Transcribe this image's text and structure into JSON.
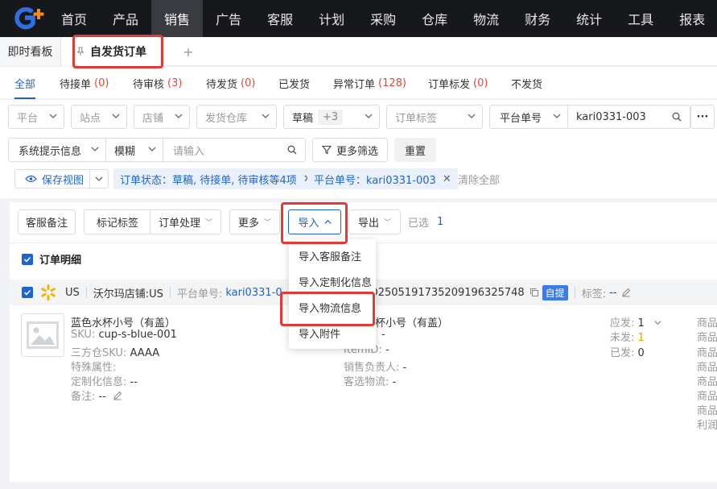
{
  "nav": {
    "items": [
      "首页",
      "产品",
      "销售",
      "广告",
      "客服",
      "计划",
      "采购",
      "仓库",
      "物流",
      "财务",
      "统计",
      "工具",
      "报表"
    ],
    "active_index": 2
  },
  "tabs": {
    "home": "即时看板",
    "current": "自发货订单",
    "add": "+"
  },
  "status_tabs": [
    {
      "label": "全部",
      "count": ""
    },
    {
      "label": "待接单",
      "count": "(0)"
    },
    {
      "label": "待审核",
      "count": "(3)"
    },
    {
      "label": "待发货",
      "count": "(0)"
    },
    {
      "label": "已发货",
      "count": ""
    },
    {
      "label": "异常订单",
      "count": "(128)"
    },
    {
      "label": "订单标发",
      "count": "(0)"
    },
    {
      "label": "不发货",
      "count": ""
    }
  ],
  "filters": {
    "platform": "平台",
    "site": "站点",
    "shop": "店铺",
    "warehouse": "发货仓库",
    "status": "草稿",
    "status_more": "+3",
    "order_tag": "订单标签",
    "search_field": "平台单号",
    "search_value": "kari0331-003",
    "sys_info": "系统提示信息",
    "match_mode": "模糊",
    "keyword_placeholder": "请输入",
    "more_filters": "更多筛选",
    "reset": "重置",
    "save_view": "保存视图",
    "chip_status": "订单状态：草稿, 待接单, 待审核等4项",
    "chip_platform_no": "平台单号：kari0331-003",
    "clear_all": "清除全部"
  },
  "actions": {
    "cs_note": "客服备注",
    "mark_tag": "标记标签",
    "order_process": "订单处理",
    "more": "更多",
    "import": "导入",
    "export": "导出",
    "selected_label": "已选",
    "selected_count": "1"
  },
  "import_menu": [
    "导入客服备注",
    "导入定制化信息",
    "导入物流信息",
    "导入附件"
  ],
  "detail": {
    "header": "订单明细",
    "order": {
      "country": "US",
      "shop": "沃尔玛店铺:US",
      "platform_no_label": "平台单号:",
      "platform_no": "kari0331-0",
      "order_no_label": "号:",
      "order_no": "FO2505191735209196325748",
      "pickup_badge": "自提",
      "tag_label": "标签:",
      "tag_value": "--"
    },
    "product": {
      "name": "蓝色水杯小号（有盖）",
      "sku_label": "SKU:",
      "sku": "cup-s-blue-001",
      "tp_sku_label": "三方仓SKU:",
      "tp_sku": "AAAA",
      "special_attr": "特殊属性:",
      "custom_info_label": "定制化信息:",
      "custom_info": "--",
      "remark_label": "备注:",
      "remark": "--"
    },
    "middle": {
      "name_tail": "杯小号（有盖）",
      "dash1": "-",
      "item_id_label": "ItemID:",
      "item_id": "-",
      "sales_owner_label": "销售负责人:",
      "sales_owner": "-",
      "logistics_label": "客选物流:",
      "logistics": "-"
    },
    "qty": {
      "should_label": "应发:",
      "should": "1",
      "unsent_label": "未发:",
      "unsent": "1",
      "sent_label": "已发:",
      "sent": "0"
    },
    "right_labels": [
      "商品",
      "商品",
      "商品",
      "商品",
      "商品",
      "商品",
      "商品",
      "利润"
    ]
  },
  "colors": {
    "accent": "#1d63d6",
    "nav_bg": "#17181c",
    "highlight": "#e53935",
    "danger_count": "#e0473b"
  }
}
